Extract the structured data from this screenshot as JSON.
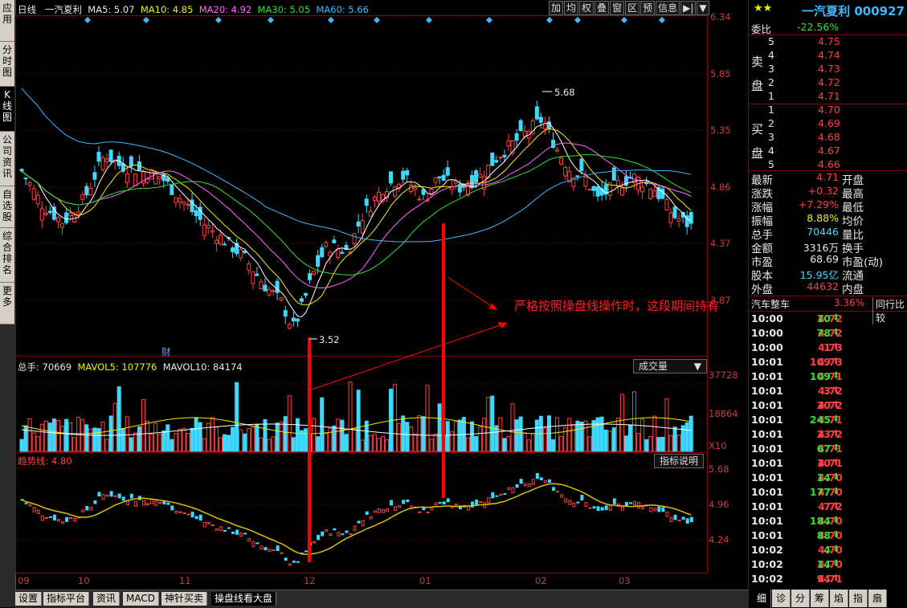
{
  "left_tabs": [
    {
      "label": "应用",
      "active": false
    },
    {
      "label": "分时图",
      "active": false
    },
    {
      "label": "K线图",
      "active": true
    },
    {
      "label": "公司资讯",
      "active": false
    },
    {
      "label": "自选股",
      "active": false
    },
    {
      "label": "综合排名",
      "active": false
    },
    {
      "label": "更多",
      "active": false
    }
  ],
  "header": {
    "period": "日线",
    "stock": "一汽夏利",
    "ma5": "MA5: 5.07",
    "ma10": "MA10: 4.85",
    "ma20": "MA20: 4.92",
    "ma30": "MA30: 5.05",
    "ma60": "MA60: 5.66"
  },
  "toolbar": [
    "加",
    "均",
    "权",
    "叠",
    "窗",
    "区",
    "预",
    "信息",
    "▶|",
    "▼"
  ],
  "price_axis": [
    "6.34",
    "5.85",
    "5.35",
    "4.86",
    "4.37",
    "3.87"
  ],
  "price_marks": {
    "high": "5.68",
    "low": "3.52",
    "cai": "财"
  },
  "annotation": "严格按照操盘线操作时，这段期间持有",
  "volume_panel": {
    "label": "总手: 70669",
    "mavol5": "MAVOL5: 107776",
    "mavol10": "MAVOL10: 84174",
    "dropdown": "成交量",
    "axis": [
      "37728",
      "18864",
      "X10"
    ]
  },
  "indicator_panel": {
    "label": "趋势线: 4.80",
    "button": "指标说明",
    "axis": [
      "5.68",
      "4.96",
      "4.24"
    ]
  },
  "date_axis": [
    "09",
    "10",
    "11",
    "12",
    "01",
    "02",
    "03"
  ],
  "bottom_tabs": [
    "设置",
    "指标平台",
    "资讯",
    "MACD",
    "神针买卖",
    "操盘线看大盘"
  ],
  "right": {
    "stars": "★★",
    "title": "一汽夏利 000927",
    "weibi_label": "委比",
    "weibi_value": "-22.56%",
    "sell_label": "卖盘",
    "buy_label": "买盘",
    "sell": [
      {
        "n": "5",
        "p": "4.75"
      },
      {
        "n": "4",
        "p": "4.74"
      },
      {
        "n": "3",
        "p": "4.73"
      },
      {
        "n": "2",
        "p": "4.72"
      },
      {
        "n": "1",
        "p": "4.71"
      }
    ],
    "buy": [
      {
        "n": "1",
        "p": "4.70"
      },
      {
        "n": "2",
        "p": "4.69"
      },
      {
        "n": "3",
        "p": "4.68"
      },
      {
        "n": "4",
        "p": "4.67"
      },
      {
        "n": "5",
        "p": "4.66"
      }
    ],
    "stats": [
      {
        "k": "最新",
        "v": "4.71",
        "k2": "开盘",
        "c": "red"
      },
      {
        "k": "涨跌",
        "v": "+0.32",
        "k2": "最高",
        "c": "red"
      },
      {
        "k": "涨幅",
        "v": "+7.29%",
        "k2": "最低",
        "c": "red"
      },
      {
        "k": "振幅",
        "v": "8.88%",
        "k2": "均价",
        "c": "yellow"
      },
      {
        "k": "总手",
        "v": "70446",
        "k2": "量比",
        "c": "cyan"
      },
      {
        "k": "金额",
        "v": "3316万",
        "k2": "换手",
        "c": "white"
      },
      {
        "k": "市盈",
        "v": "68.69",
        "k2": "市盈(动)",
        "c": "white"
      },
      {
        "k": "股本",
        "v": "15.95亿",
        "k2": "流通",
        "c": "cyan"
      },
      {
        "k": "外盘",
        "v": "44632",
        "k2": "内盘",
        "c": "red"
      }
    ],
    "sector_name": "汽车整车",
    "sector_pct": "3.36%",
    "sector_tab": "同行比较",
    "ticks": [
      {
        "t": "10:00",
        "p": "4.72",
        "v": "10",
        "d": "down"
      },
      {
        "t": "10:00",
        "p": "4.72",
        "v": "78",
        "d": "down"
      },
      {
        "t": "10:00",
        "p": "4.73",
        "v": "1",
        "d": "up"
      },
      {
        "t": "10:01",
        "p": "4.73",
        "v": "109",
        "d": "up"
      },
      {
        "t": "10:01",
        "p": "4.71",
        "v": "109",
        "d": "down"
      },
      {
        "t": "10:01",
        "p": "4.72",
        "v": "3",
        "d": "up"
      },
      {
        "t": "10:01",
        "p": "4.72",
        "v": "20",
        "d": "up"
      },
      {
        "t": "10:01",
        "p": "4.71",
        "v": "245",
        "d": "down"
      },
      {
        "t": "10:01",
        "p": "4.72",
        "v": "23",
        "d": "up"
      },
      {
        "t": "10:01",
        "p": "4.71",
        "v": "67",
        "d": "down"
      },
      {
        "t": "10:01",
        "p": "4.71",
        "v": "10",
        "d": "up"
      },
      {
        "t": "10:01",
        "p": "4.70",
        "v": "14",
        "d": "down"
      },
      {
        "t": "10:01",
        "p": "4.70",
        "v": "177",
        "d": "down"
      },
      {
        "t": "10:01",
        "p": "4.72",
        "v": "7",
        "d": "up"
      },
      {
        "t": "10:01",
        "p": "4.70",
        "v": "184",
        "d": "down"
      },
      {
        "t": "10:01",
        "p": "4.70",
        "v": "88",
        "d": "down"
      },
      {
        "t": "10:02",
        "p": "4.70",
        "v": "4",
        "d": "down"
      },
      {
        "t": "10:02",
        "p": "4.70",
        "v": "14",
        "d": "down"
      },
      {
        "t": "10:02",
        "p": "4.71",
        "v": "94",
        "d": "up"
      }
    ],
    "bottom_tabs": [
      "细",
      "诊",
      "分",
      "筹",
      "焰",
      "指",
      "扇"
    ]
  },
  "colors": {
    "up": "#ff4040",
    "down": "#3fd8ff",
    "ma5": "#ffffff",
    "ma10": "#f0f000",
    "ma20": "#ff66ff",
    "ma30": "#33dd33",
    "ma60": "#3fb8ff"
  }
}
